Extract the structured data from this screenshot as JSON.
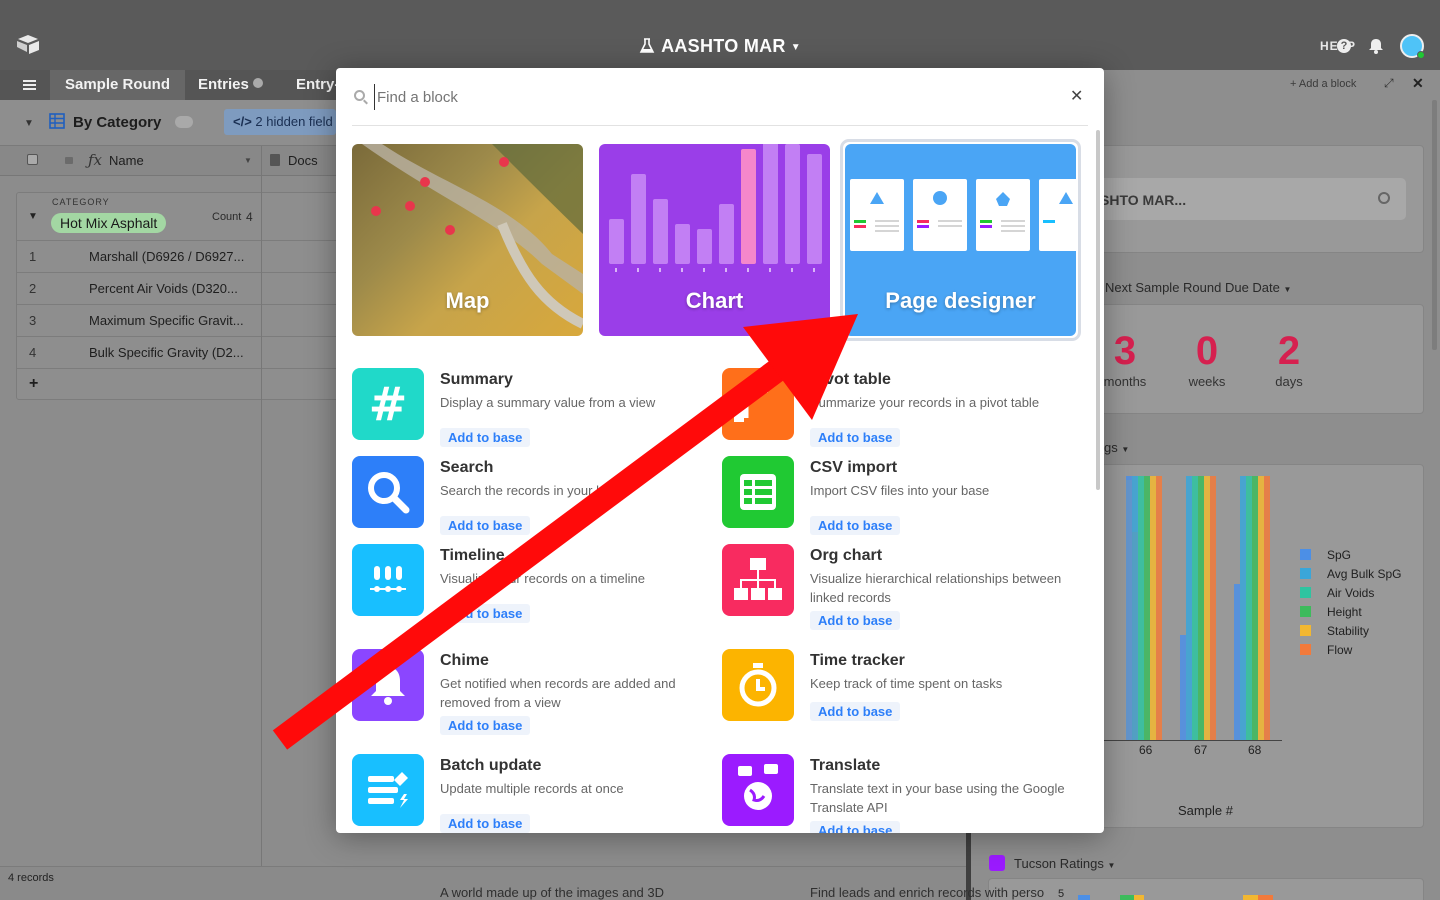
{
  "app": {
    "base_name": "AASHTO MAR",
    "help": "HELP"
  },
  "tabs": [
    {
      "label": "Sample Round"
    },
    {
      "label": "Entries"
    },
    {
      "label": "Entry-"
    }
  ],
  "view": {
    "name": "By Category",
    "hidden_fields": "2 hidden field"
  },
  "grid": {
    "columns": [
      {
        "label": "Name"
      },
      {
        "label": "Docs"
      }
    ],
    "group": {
      "label": "CATEGORY",
      "value": "Hot Mix Asphalt",
      "count_label": "Count",
      "count": "4"
    },
    "rows": [
      {
        "num": "1",
        "name": "Marshall (D6926 / D6927..."
      },
      {
        "num": "2",
        "name": "Percent Air Voids (D320..."
      },
      {
        "num": "3",
        "name": "Maximum Specific Gravit..."
      },
      {
        "num": "4",
        "name": "Bulk Specific Gravity (D2..."
      }
    ],
    "add_row": "+",
    "record_count": "4 records"
  },
  "blocks_panel": {
    "add_block": "+ Add a block",
    "search_value": "SHTO MAR...",
    "due_date_label": "Next Sample Round Due Date",
    "countdown": [
      {
        "value": "3",
        "unit": "months"
      },
      {
        "value": "0",
        "unit": "weeks"
      },
      {
        "value": "2",
        "unit": "days"
      }
    ],
    "chart_title_fragment": "gs",
    "legend": [
      {
        "name": "SpG",
        "color": "#4c8fe6"
      },
      {
        "name": "Avg Bulk SpG",
        "color": "#3aa6d9"
      },
      {
        "name": "Air Voids",
        "color": "#2ec4a0"
      },
      {
        "name": "Height",
        "color": "#3dbb5c"
      },
      {
        "name": "Stability",
        "color": "#f2b731"
      },
      {
        "name": "Flow",
        "color": "#f27a3b"
      }
    ],
    "x_ticks": [
      "66",
      "67",
      "68"
    ],
    "xlabel": "Sample #",
    "tucson_label": "Tucson Ratings",
    "tucson_tick": "5"
  },
  "modal": {
    "search_placeholder": "Find a block",
    "featured": [
      {
        "label": "Map"
      },
      {
        "label": "Chart"
      },
      {
        "label": "Page designer"
      }
    ],
    "add_label": "Add to base",
    "blocks": [
      {
        "title": "Summary",
        "desc": "Display a summary value from a view",
        "color": "#20d9c9",
        "icon": "hash-icon"
      },
      {
        "title": "Pivot table",
        "desc": "Summarize your records in a pivot table",
        "color": "#ff6f1a",
        "icon": "pivot-icon"
      },
      {
        "title": "Search",
        "desc": "Search the records in your base",
        "color": "#2d7ff9",
        "icon": "search-icon"
      },
      {
        "title": "CSV import",
        "desc": "Import CSV files into your base",
        "color": "#20c933",
        "icon": "grid-icon"
      },
      {
        "title": "Timeline",
        "desc": "Visualize your records on a timeline",
        "color": "#18bfff",
        "icon": "timeline-icon"
      },
      {
        "title": "Org chart",
        "desc": "Visualize hierarchical relationships between linked records",
        "color": "#f82b60",
        "icon": "org-chart-icon"
      },
      {
        "title": "Chime",
        "desc": "Get notified when records are added and removed from a view",
        "color": "#8b46ff",
        "icon": "bell-icon"
      },
      {
        "title": "Time tracker",
        "desc": "Keep track of time spent on tasks",
        "color": "#fcb400",
        "icon": "stopwatch-icon"
      },
      {
        "title": "Batch update",
        "desc": "Update multiple records at once",
        "color": "#18bfff",
        "icon": "list-edit-icon"
      },
      {
        "title": "Translate",
        "desc": "Translate text in your base using the Google Translate API",
        "color": "#9b1bff",
        "icon": "globe-chat-icon"
      }
    ],
    "peek_left": "A world made up of the images and 3D",
    "peek_right": "Find leads and enrich records with perso"
  }
}
